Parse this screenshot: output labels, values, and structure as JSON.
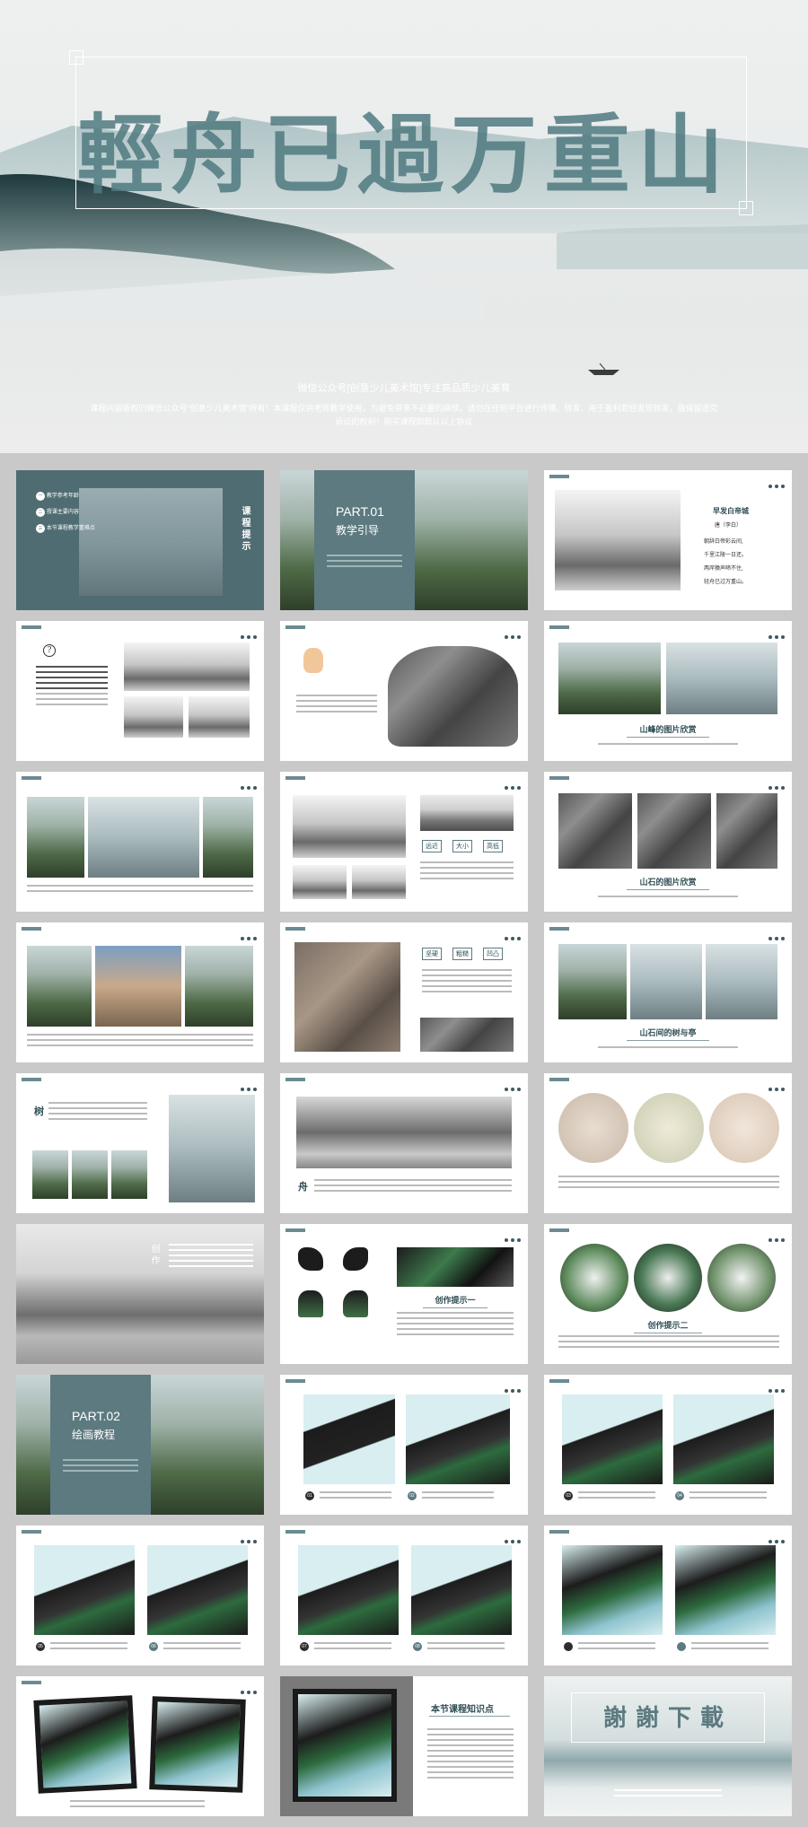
{
  "hero": {
    "title": "輕舟已過万重山",
    "subtitle": "微信公众号[创意少儿美术馆]专注高品质少儿美育",
    "disclaimer": "课程内容版权归微信公众号“创意少儿美术馆”所有！本课程仅供老师教学使用，为避免带来不必要的麻烦，请勿在任何平台进行传播、转发、用于盈利若经发现转发，我保留追究诉讼的权利！购买课程即默认以上协议"
  },
  "slides": {
    "s1": {
      "items": [
        "教学参考年龄",
        "授课主要内容",
        "本节课程教学重难点"
      ],
      "badges": [
        "一",
        "二",
        "三"
      ],
      "side_title": "课程提示"
    },
    "s2": {
      "part": "PART.01",
      "title": "教学引导"
    },
    "s3": {
      "poem_title": "早发白帝城",
      "author": "唐（李白）",
      "lines": [
        "朝辞白帝彩云间,",
        "千里江陵一日还。",
        "两岸猿声啼不住,",
        "轻舟已过万重山。"
      ]
    },
    "s6": {
      "caption": "山峰的图片欣赏"
    },
    "s8": {
      "tags": [
        "远近",
        "大小",
        "高低"
      ]
    },
    "s9": {
      "caption": "山石的图片欣赏"
    },
    "s11": {
      "tags": [
        "坚硬",
        "粗糙",
        "凹凸"
      ]
    },
    "s12": {
      "caption": "山石间的树与亭"
    },
    "s13": {
      "char": "树"
    },
    "s14": {
      "char": "舟"
    },
    "s16": {
      "char": "创作"
    },
    "s17": {
      "caption": "创作提示一"
    },
    "s18": {
      "caption": "创作提示二"
    },
    "s19": {
      "part": "PART.02",
      "title": "绘画教程"
    },
    "s26": {
      "title": "本节课程知识点"
    },
    "s27": {
      "title": "謝謝下載"
    }
  },
  "colors": {
    "accent": "#5c7a80",
    "page_bg": "#c9c9c9"
  },
  "steps": [
    "01",
    "02",
    "03",
    "04",
    "05",
    "06",
    "07",
    "08"
  ]
}
